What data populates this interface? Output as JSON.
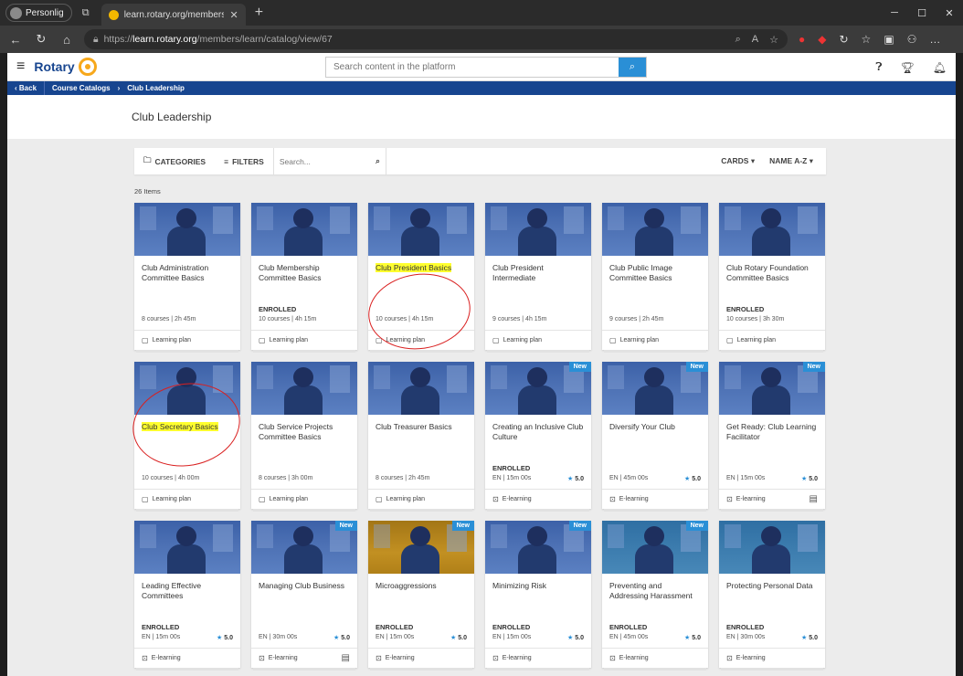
{
  "browser": {
    "profile": "Personlig",
    "tab_title": "learn.rotary.org/members/learn/c",
    "url_prefix": "https://",
    "url_host": "learn.rotary.org",
    "url_path": "/members/learn/catalog/view/67"
  },
  "app": {
    "brand": "Rotary",
    "search_placeholder": "Search content in the platform"
  },
  "breadcrumb": {
    "back": "Back",
    "items": [
      "Course Catalogs",
      "Club Leadership"
    ]
  },
  "page_title": "Club Leadership",
  "toolbar": {
    "categories": "CATEGORIES",
    "filters": "FILTERS",
    "search_placeholder": "Search...",
    "view": "CARDS",
    "sort": "NAME A-Z"
  },
  "items_count": "26 Items",
  "cards": [
    {
      "title": "Club Administration Committee Basics",
      "enrolled": "",
      "meta": "8 courses | 2h 45m",
      "rating": "",
      "type": "Learning plan",
      "badge": "",
      "thumb": "blue"
    },
    {
      "title": "Club Membership Committee Basics",
      "enrolled": "ENROLLED",
      "meta": "10 courses | 4h 15m",
      "rating": "",
      "type": "Learning plan",
      "badge": "",
      "thumb": "blue"
    },
    {
      "title": "Club President Basics",
      "enrolled": "",
      "meta": "10 courses | 4h 15m",
      "rating": "",
      "type": "Learning plan",
      "badge": "",
      "thumb": "blue",
      "highlight": true
    },
    {
      "title": "Club President Intermediate",
      "enrolled": "",
      "meta": "9 courses | 4h 15m",
      "rating": "",
      "type": "Learning plan",
      "badge": "",
      "thumb": "blue"
    },
    {
      "title": "Club Public Image Committee Basics",
      "enrolled": "",
      "meta": "9 courses | 2h 45m",
      "rating": "",
      "type": "Learning plan",
      "badge": "",
      "thumb": "blue"
    },
    {
      "title": "Club Rotary Foundation Committee Basics",
      "enrolled": "ENROLLED",
      "meta": "10 courses | 3h 30m",
      "rating": "",
      "type": "Learning plan",
      "badge": "",
      "thumb": "blue"
    },
    {
      "title": "Club Secretary Basics",
      "enrolled": "",
      "meta": "10 courses | 4h 00m",
      "rating": "",
      "type": "Learning plan",
      "badge": "",
      "thumb": "blue",
      "highlight": true
    },
    {
      "title": "Club Service Projects Committee Basics",
      "enrolled": "",
      "meta": "8 courses | 3h 00m",
      "rating": "",
      "type": "Learning plan",
      "badge": "",
      "thumb": "blue"
    },
    {
      "title": "Club Treasurer Basics",
      "enrolled": "",
      "meta": "8 courses | 2h 45m",
      "rating": "",
      "type": "Learning plan",
      "badge": "",
      "thumb": "blue"
    },
    {
      "title": "Creating an Inclusive Club Culture",
      "enrolled": "ENROLLED",
      "meta": "EN | 15m 00s",
      "rating": "5.0",
      "type": "E-learning",
      "badge": "New",
      "thumb": "blue"
    },
    {
      "title": "Diversify Your Club",
      "enrolled": "",
      "meta": "EN | 45m 00s",
      "rating": "5.0",
      "type": "E-learning",
      "badge": "New",
      "thumb": "blue"
    },
    {
      "title": "Get Ready: Club Learning Facilitator",
      "enrolled": "",
      "meta": "EN | 15m 00s",
      "rating": "5.0",
      "type": "E-learning",
      "badge": "New",
      "thumb": "blue",
      "chat": true
    },
    {
      "title": "Leading Effective Committees",
      "enrolled": "ENROLLED",
      "meta": "EN | 15m 00s",
      "rating": "5.0",
      "type": "E-learning",
      "badge": "",
      "thumb": "blue"
    },
    {
      "title": "Managing Club Business",
      "enrolled": "",
      "meta": "EN | 30m 00s",
      "rating": "5.0",
      "type": "E-learning",
      "badge": "New",
      "thumb": "blue",
      "chat": true
    },
    {
      "title": "Microaggressions",
      "enrolled": "ENROLLED",
      "meta": "EN | 15m 00s",
      "rating": "5.0",
      "type": "E-learning",
      "badge": "New",
      "thumb": "gold"
    },
    {
      "title": "Minimizing Risk",
      "enrolled": "ENROLLED",
      "meta": "EN | 15m 00s",
      "rating": "5.0",
      "type": "E-learning",
      "badge": "New",
      "thumb": "blue"
    },
    {
      "title": "Preventing and Addressing Harassment",
      "enrolled": "ENROLLED",
      "meta": "EN | 45m 00s",
      "rating": "5.0",
      "type": "E-learning",
      "badge": "New",
      "thumb": "teal"
    },
    {
      "title": "Protecting Personal Data",
      "enrolled": "ENROLLED",
      "meta": "EN | 30m 00s",
      "rating": "5.0",
      "type": "E-learning",
      "badge": "",
      "thumb": "teal"
    }
  ]
}
